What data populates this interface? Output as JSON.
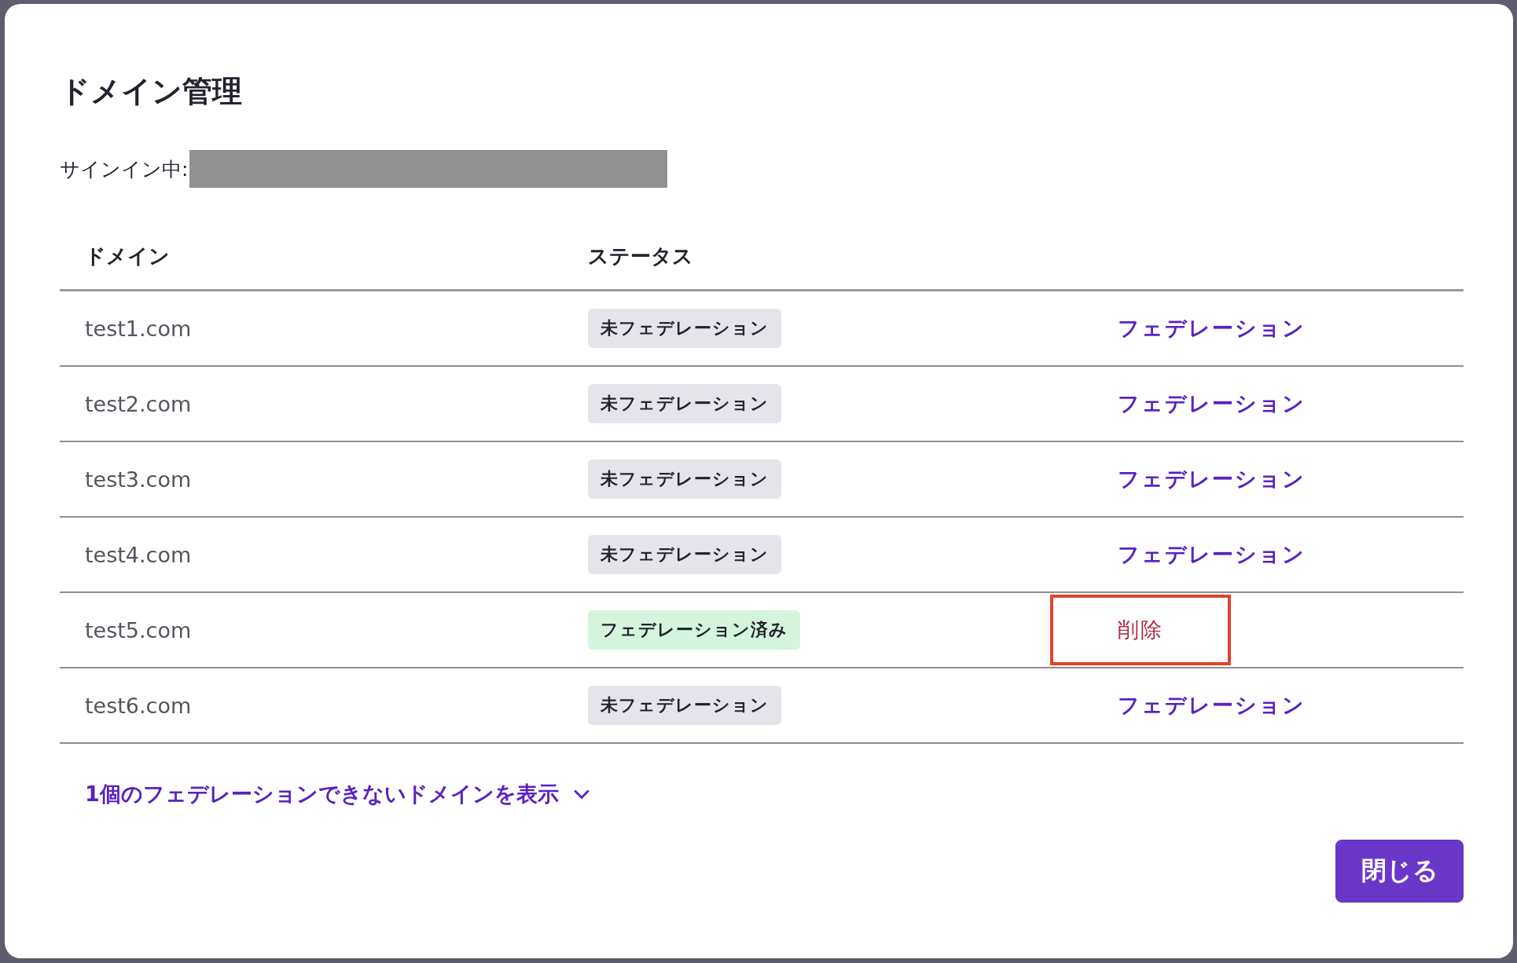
{
  "dialog": {
    "title": "ドメイン管理",
    "signed_in_label": "サインイン中:"
  },
  "table": {
    "columns": [
      "ドメイン",
      "ステータス"
    ],
    "rows": [
      {
        "domain": "test1.com",
        "status": {
          "label": "未フェデレーション",
          "kind": "pending"
        },
        "action": {
          "label": "フェデレーション",
          "kind": "federate",
          "highlighted": false
        }
      },
      {
        "domain": "test2.com",
        "status": {
          "label": "未フェデレーション",
          "kind": "pending"
        },
        "action": {
          "label": "フェデレーション",
          "kind": "federate",
          "highlighted": false
        }
      },
      {
        "domain": "test3.com",
        "status": {
          "label": "未フェデレーション",
          "kind": "pending"
        },
        "action": {
          "label": "フェデレーション",
          "kind": "federate",
          "highlighted": false
        }
      },
      {
        "domain": "test4.com",
        "status": {
          "label": "未フェデレーション",
          "kind": "pending"
        },
        "action": {
          "label": "フェデレーション",
          "kind": "federate",
          "highlighted": false
        }
      },
      {
        "domain": "test5.com",
        "status": {
          "label": "フェデレーション済み",
          "kind": "federated"
        },
        "action": {
          "label": "削除",
          "kind": "delete",
          "highlighted": true
        }
      },
      {
        "domain": "test6.com",
        "status": {
          "label": "未フェデレーション",
          "kind": "pending"
        },
        "action": {
          "label": "フェデレーション",
          "kind": "federate",
          "highlighted": false
        }
      }
    ]
  },
  "expander": {
    "label": "1個のフェデレーションできないドメインを表示",
    "expanded": false
  },
  "buttons": [
    {
      "label": "閉じる"
    }
  ]
}
